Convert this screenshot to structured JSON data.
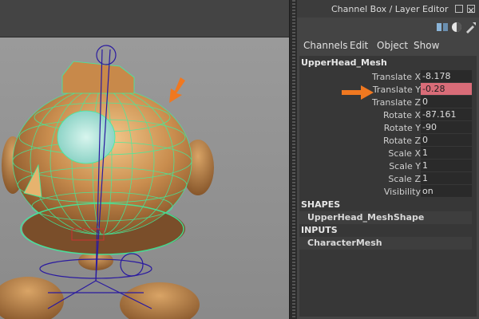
{
  "panel": {
    "title": "Channel Box / Layer Editor",
    "menu": [
      "Channels",
      "Edit",
      "Object",
      "Show"
    ]
  },
  "object": {
    "name": "UpperHead_Mesh",
    "attributes": [
      {
        "label": "Translate X",
        "value": "-8.178",
        "highlighted": false
      },
      {
        "label": "Translate Y",
        "value": "-0.28",
        "highlighted": true
      },
      {
        "label": "Translate Z",
        "value": "0",
        "highlighted": false
      },
      {
        "label": "Rotate X",
        "value": "-87.161",
        "highlighted": false
      },
      {
        "label": "Rotate Y",
        "value": "-90",
        "highlighted": false
      },
      {
        "label": "Rotate Z",
        "value": "0",
        "highlighted": false
      },
      {
        "label": "Scale X",
        "value": "1",
        "highlighted": false
      },
      {
        "label": "Scale Y",
        "value": "1",
        "highlighted": false
      },
      {
        "label": "Scale Z",
        "value": "1",
        "highlighted": false
      },
      {
        "label": "Visibility",
        "value": "on",
        "highlighted": false
      }
    ]
  },
  "shapes": {
    "header": "SHAPES",
    "item": "UpperHead_MeshShape"
  },
  "inputs": {
    "header": "INPUTS",
    "item": "CharacterMesh"
  },
  "colors": {
    "highlight": "#d96c78",
    "annotation_arrow": "#f07820",
    "wireframe": "#3cf0a0",
    "rig": "#2a1aa0"
  },
  "icons": [
    "channel-box-icon",
    "attribute-editor-icon",
    "tool-settings-icon"
  ]
}
